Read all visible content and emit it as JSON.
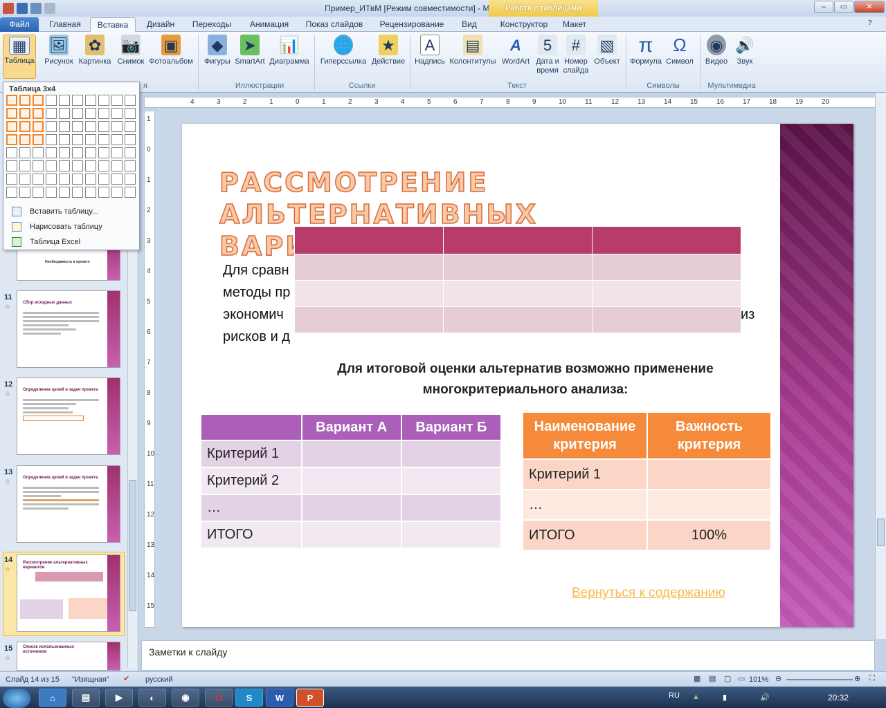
{
  "window": {
    "title": "Пример_ИТвМ [Режим совместимости] - Microsoft PowerPoint",
    "context_tab_header": "Работа с таблицами"
  },
  "tabs": [
    "Файл",
    "Главная",
    "Вставка",
    "Дизайн",
    "Переходы",
    "Анимация",
    "Показ слайдов",
    "Рецензирование",
    "Вид",
    "Конструктор",
    "Макет"
  ],
  "ribbon": {
    "buttons": [
      "Таблица",
      "Рисунок",
      "Картинка",
      "Снимок",
      "Фотоальбом",
      "Фигуры",
      "SmartArt",
      "Диаграмма",
      "Гиперссылка",
      "Действие",
      "Надпись",
      "Колонтитулы",
      "WordArt",
      "Дата и время",
      "Номер слайда",
      "Объект",
      "Формула",
      "Символ",
      "Видео",
      "Звук"
    ],
    "groups": [
      "я",
      "Иллюстрации",
      "Ссылки",
      "Текст",
      "Символы",
      "Мультимедиа"
    ]
  },
  "table_menu": {
    "header": "Таблица 3x4",
    "items": [
      "Вставить таблицу...",
      "Нарисовать таблицу",
      "Таблица Excel"
    ]
  },
  "thumbnails": [
    {
      "num": "11",
      "title": "Сбор исходных данных"
    },
    {
      "num": "12",
      "title": "Определение целей и задач проекта"
    },
    {
      "num": "13",
      "title": "Определение целей и задач проекта"
    },
    {
      "num": "14",
      "title": "Рассмотрение альтернативных вариантов"
    },
    {
      "num": "15",
      "title": "Список использованных источников"
    }
  ],
  "thumb_partial_caption": "Необходимость в проекте",
  "ruler": {
    "h_ticks": [
      "4",
      "3",
      "2",
      "1",
      "0",
      "1",
      "2",
      "3",
      "4",
      "5",
      "6",
      "7",
      "8",
      "9",
      "10",
      "11",
      "12",
      "13",
      "14",
      "15",
      "16",
      "17",
      "18",
      "19",
      "20"
    ],
    "v_ticks": [
      "1",
      "0",
      "1",
      "2",
      "3",
      "4",
      "5",
      "6",
      "7",
      "8",
      "9",
      "10",
      "11",
      "12",
      "13",
      "14",
      "15"
    ]
  },
  "slide": {
    "title": "Рассмотрение альтернативных вариантов",
    "body_text": "Для сравн... методы пр... экономич... из рисков и д...",
    "body_lines": [
      "Для сравн",
      "методы пр",
      "экономич",
      "рисков и д"
    ],
    "body_line3_tail": "из",
    "mca_heading": "Для итоговой оценки альтернатив возможно применение многокритериального анализа:",
    "criteria_table": {
      "header": [
        "",
        "Вариант А",
        "Вариант Б"
      ],
      "rows": [
        "Критерий 1",
        "Критерий 2",
        "…",
        "ИТОГО"
      ]
    },
    "importance_table": {
      "header": [
        "Наименование критерия",
        "Важность критерия"
      ],
      "rows": [
        [
          "Критерий 1",
          ""
        ],
        [
          "…",
          ""
        ],
        [
          "ИТОГО",
          "100%"
        ]
      ]
    },
    "back_link": "Вернуться к содержанию"
  },
  "notes_placeholder": "Заметки к слайду",
  "status": {
    "slide_info": "Слайд 14 из 15",
    "theme": "\"Изящная\"",
    "language": "русский",
    "zoom": "101%"
  },
  "taskbar": {
    "lang": "RU",
    "time": "20:32",
    "apps": [
      "S",
      "W",
      "P"
    ]
  },
  "colors": {
    "title_orange": "#f8c9a6",
    "purple_header": "#ab5fb8",
    "orange_header": "#f48a3a",
    "deco_purple": "#a53a8e",
    "link": "#f7b94f"
  }
}
